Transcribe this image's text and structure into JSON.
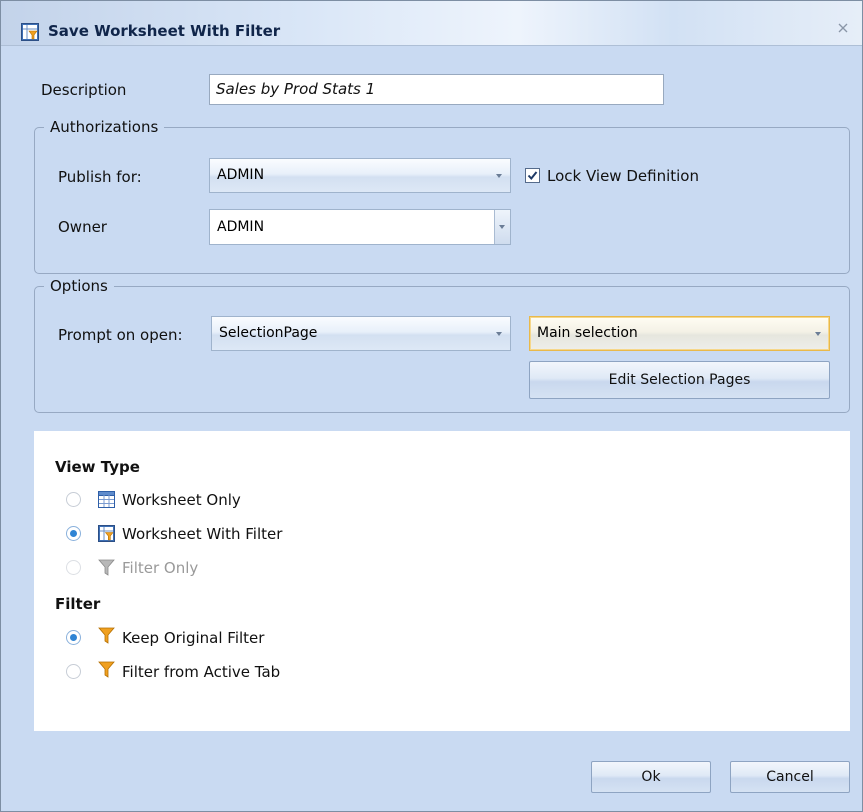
{
  "dialog": {
    "title": "Save Worksheet With Filter",
    "icons": {
      "title": "worksheet-filter-icon",
      "close": "close-icon"
    }
  },
  "description": {
    "label": "Description",
    "value": "Sales by Prod Stats 1"
  },
  "authorizations": {
    "legend": "Authorizations",
    "publish_for": {
      "label": "Publish for:",
      "value": "ADMIN"
    },
    "lock_view": {
      "label": "Lock View Definition",
      "checked": true
    },
    "owner": {
      "label": "Owner",
      "value": "ADMIN"
    }
  },
  "options": {
    "legend": "Options",
    "prompt_on_open": {
      "label": "Prompt on open:",
      "value": "SelectionPage"
    },
    "selection": {
      "value": "Main selection"
    },
    "edit_button": "Edit Selection Pages"
  },
  "view_type": {
    "title": "View Type",
    "options": [
      {
        "label": "Worksheet Only",
        "icon": "worksheet-icon",
        "selected": false,
        "disabled": false
      },
      {
        "label": "Worksheet With Filter",
        "icon": "worksheet-filter-icon",
        "selected": true,
        "disabled": false
      },
      {
        "label": "Filter Only",
        "icon": "filter-gray-icon",
        "selected": false,
        "disabled": true
      }
    ]
  },
  "filter": {
    "title": "Filter",
    "options": [
      {
        "label": "Keep Original Filter",
        "icon": "filter-icon",
        "selected": true
      },
      {
        "label": "Filter from Active Tab",
        "icon": "filter-icon",
        "selected": false
      }
    ]
  },
  "buttons": {
    "ok": "Ok",
    "cancel": "Cancel"
  },
  "colors": {
    "dialog_bg": "#c9daf2",
    "radio_accent": "#2f84d4",
    "focus_border": "#e9b94b",
    "filter_icon": "#f0a020"
  }
}
